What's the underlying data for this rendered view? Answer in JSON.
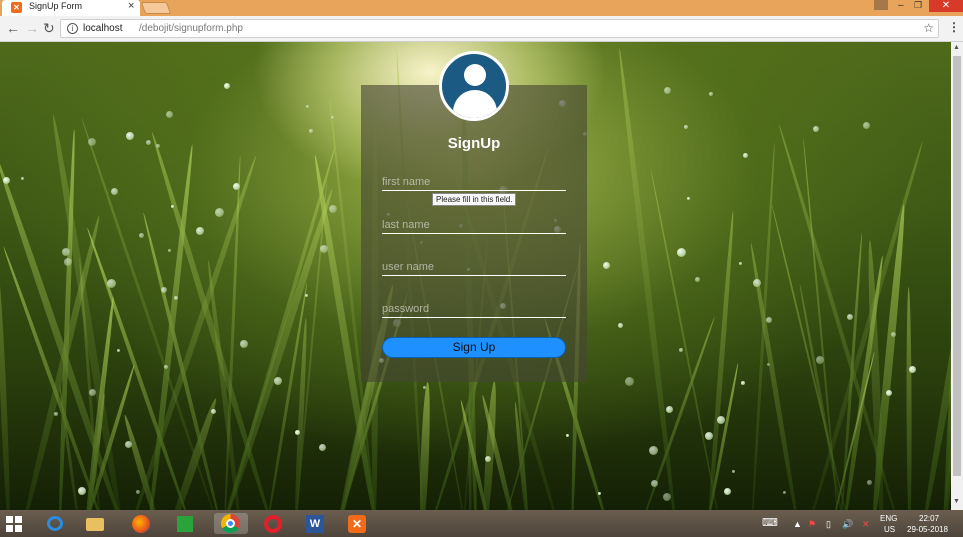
{
  "browser": {
    "tab_title": "SignUp Form",
    "tab_close": "×",
    "url_host": "localhost",
    "url_path": "/debojit/signupform.php",
    "back": "←",
    "forward": "→",
    "reload": "↻",
    "bookmark": "☆",
    "menu": "⋮",
    "window_min": "–",
    "window_max": "❐",
    "window_close": "✕"
  },
  "signup": {
    "title": "SignUp",
    "first_name_placeholder": "first name",
    "last_name_placeholder": "last name",
    "user_name_placeholder": "user name",
    "password_placeholder": "password",
    "submit_label": "Sign Up",
    "validation_tooltip": "Please fill in this field.",
    "button_color": "#1e90ff",
    "avatar_color": "#1b5a82"
  },
  "taskbar": {
    "apps": [
      "internet-explorer-icon",
      "file-explorer-icon",
      "firefox-icon",
      "store-icon",
      "chrome-icon",
      "opera-icon",
      "word-icon",
      "xampp-icon"
    ],
    "language_top": "ENG",
    "language_bottom": "US",
    "time": "22:07",
    "date": "29-05-2018"
  }
}
